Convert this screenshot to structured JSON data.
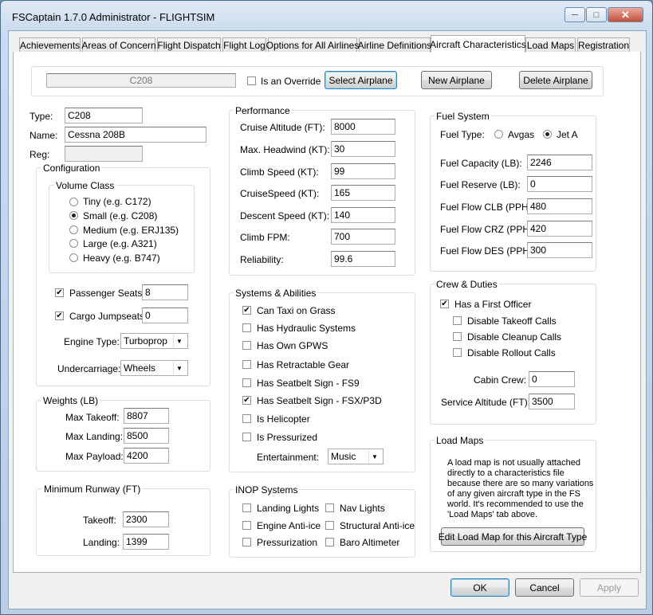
{
  "window": {
    "title": "FSCaptain 1.7.0 Administrator - FLIGHTSIM",
    "minimize": "─",
    "maximize": "□",
    "close": "✕"
  },
  "tabs": [
    {
      "label": "Achievements"
    },
    {
      "label": "Areas of Concern"
    },
    {
      "label": "Flight Dispatch"
    },
    {
      "label": "Flight Log"
    },
    {
      "label": "Options for All Airlines"
    },
    {
      "label": "Airline Definitions"
    },
    {
      "label": "Aircraft Characteristics"
    },
    {
      "label": "Load Maps"
    },
    {
      "label": "Registration"
    }
  ],
  "toolbar": {
    "aircraft_value": "C208",
    "override_label": "Is an Override",
    "select_label": "Select Airplane",
    "new_label": "New Airplane",
    "delete_label": "Delete Airplane"
  },
  "ident": {
    "type_label": "Type:",
    "type_value": "C208",
    "name_label": "Name:",
    "name_value": "Cessna 208B",
    "reg_label": "Reg:",
    "reg_value": ""
  },
  "configuration": {
    "title": "Configuration",
    "volume_title": "Volume Class",
    "volume_options": [
      "Tiny (e.g. C172)",
      "Small (e.g. C208)",
      "Medium (e.g. ERJ135)",
      "Large (e.g. A321)",
      "Heavy (e.g. B747)"
    ],
    "passenger_label": "Passenger Seats:",
    "passenger_value": "8",
    "passenger_checked": "✔",
    "cargo_label": "Cargo Jumpseats:",
    "cargo_value": "0",
    "cargo_checked": "✔",
    "engine_label": "Engine Type:",
    "engine_value": "Turboprop",
    "undercarriage_label": "Undercarriage:",
    "undercarriage_value": "Wheels"
  },
  "weights": {
    "title": "Weights (LB)",
    "takeoff_label": "Max Takeoff:",
    "takeoff_value": "8807",
    "landing_label": "Max Landing:",
    "landing_value": "8500",
    "payload_label": "Max Payload:",
    "payload_value": "4200"
  },
  "runway": {
    "title": "Minimum Runway (FT)",
    "takeoff_label": "Takeoff:",
    "takeoff_value": "2300",
    "landing_label": "Landing:",
    "landing_value": "1399"
  },
  "performance": {
    "title": "Performance",
    "rows": [
      {
        "label": "Cruise Altitude (FT):",
        "value": "8000"
      },
      {
        "label": "Max. Headwind (KT):",
        "value": "30"
      },
      {
        "label": "Climb Speed (KT):",
        "value": "99"
      },
      {
        "label": "CruiseSpeed (KT):",
        "value": "165"
      },
      {
        "label": "Descent Speed (KT):",
        "value": "140"
      },
      {
        "label": "Climb FPM:",
        "value": "700"
      },
      {
        "label": "Reliability:",
        "value": "99.6"
      }
    ]
  },
  "systems": {
    "title": "Systems & Abilities",
    "items": [
      {
        "label": "Can Taxi on Grass",
        "mark": "✔"
      },
      {
        "label": "Has Hydraulic Systems",
        "mark": ""
      },
      {
        "label": "Has Own GPWS",
        "mark": ""
      },
      {
        "label": "Has Retractable Gear",
        "mark": ""
      },
      {
        "label": "Has Seatbelt Sign - FS9",
        "mark": ""
      },
      {
        "label": "Has Seatbelt Sign - FSX/P3D",
        "mark": "✔"
      },
      {
        "label": "Is Helicopter",
        "mark": ""
      },
      {
        "label": "Is Pressurized",
        "mark": ""
      }
    ],
    "entertainment_label": "Entertainment:",
    "entertainment_value": "Music"
  },
  "inop": {
    "title": "INOP Systems",
    "items": [
      "Landing Lights",
      "Nav Lights",
      "Engine Anti-ice",
      "Structural Anti-ice",
      "Pressurization",
      "Baro Altimeter"
    ]
  },
  "fuel": {
    "title": "Fuel System",
    "type_label": "Fuel Type:",
    "avgas_label": "Avgas",
    "jeta_label": "Jet A",
    "rows": [
      {
        "label": "Fuel Capacity (LB):",
        "value": "2246"
      },
      {
        "label": "Fuel Reserve (LB):",
        "value": "0"
      },
      {
        "label": "Fuel Flow CLB (PPH):",
        "value": "480"
      },
      {
        "label": "Fuel Flow CRZ (PPH):",
        "value": "420"
      },
      {
        "label": "Fuel Flow DES (PPH):",
        "value": "300"
      }
    ]
  },
  "crew": {
    "title": "Crew & Duties",
    "first_officer_label": "Has a First Officer",
    "first_officer_mark": "✔",
    "takeoff_calls": "Disable Takeoff Calls",
    "cleanup_calls": "Disable Cleanup Calls",
    "rollout_calls": "Disable Rollout Calls",
    "cabin_label": "Cabin Crew:",
    "cabin_value": "0",
    "service_label": "Service Altitude (FT):",
    "service_value": "3500"
  },
  "loadmaps": {
    "title": "Load Maps",
    "lines": [
      "A load map is not usually attached",
      "directly to a characteristics file",
      "because there are so many variations",
      "of any given aircraft type in the FS",
      "world.  It's recommended to use the",
      "'Load Maps' tab above."
    ],
    "button_label": "Edit Load Map for this Aircraft Type"
  },
  "footer": {
    "ok_label": "OK",
    "cancel_label": "Cancel",
    "apply_label": "Apply"
  },
  "icons": {
    "dropdown": "▼"
  }
}
